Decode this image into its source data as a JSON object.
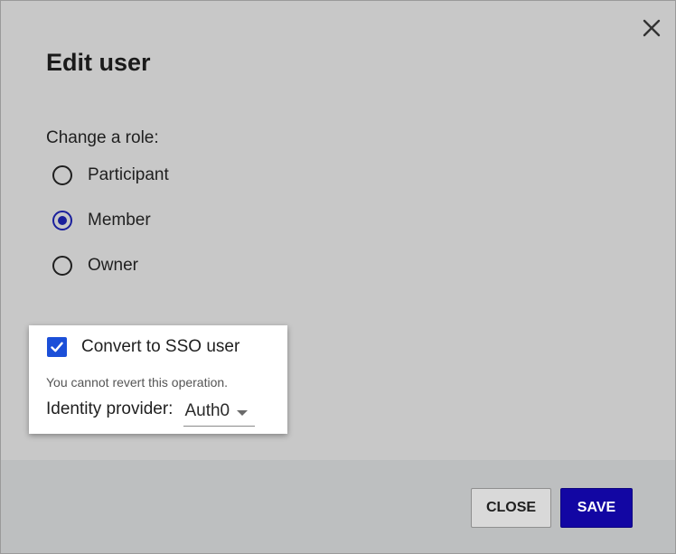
{
  "dialog": {
    "title": "Edit user",
    "close_icon": "close-icon"
  },
  "role": {
    "label": "Change a role:",
    "options": [
      {
        "label": "Participant",
        "selected": false
      },
      {
        "label": "Member",
        "selected": true
      },
      {
        "label": "Owner",
        "selected": false
      }
    ]
  },
  "sso": {
    "checkbox_label": "Convert to SSO user",
    "checked": true,
    "warning": "You cannot revert this operation.",
    "provider_label": "Identity provider:",
    "provider_value": "Auth0",
    "checkmark_icon": "checkmark-icon",
    "caret_icon": "chevron-down-icon"
  },
  "footer": {
    "close_label": "CLOSE",
    "save_label": "SAVE"
  },
  "colors": {
    "dialog_bg": "#c8c8c8",
    "footer_bg": "#bdbfc0",
    "accent_radio": "#1a1f9c",
    "checkbox": "#1b4fd8",
    "save_button": "#1206a3"
  }
}
